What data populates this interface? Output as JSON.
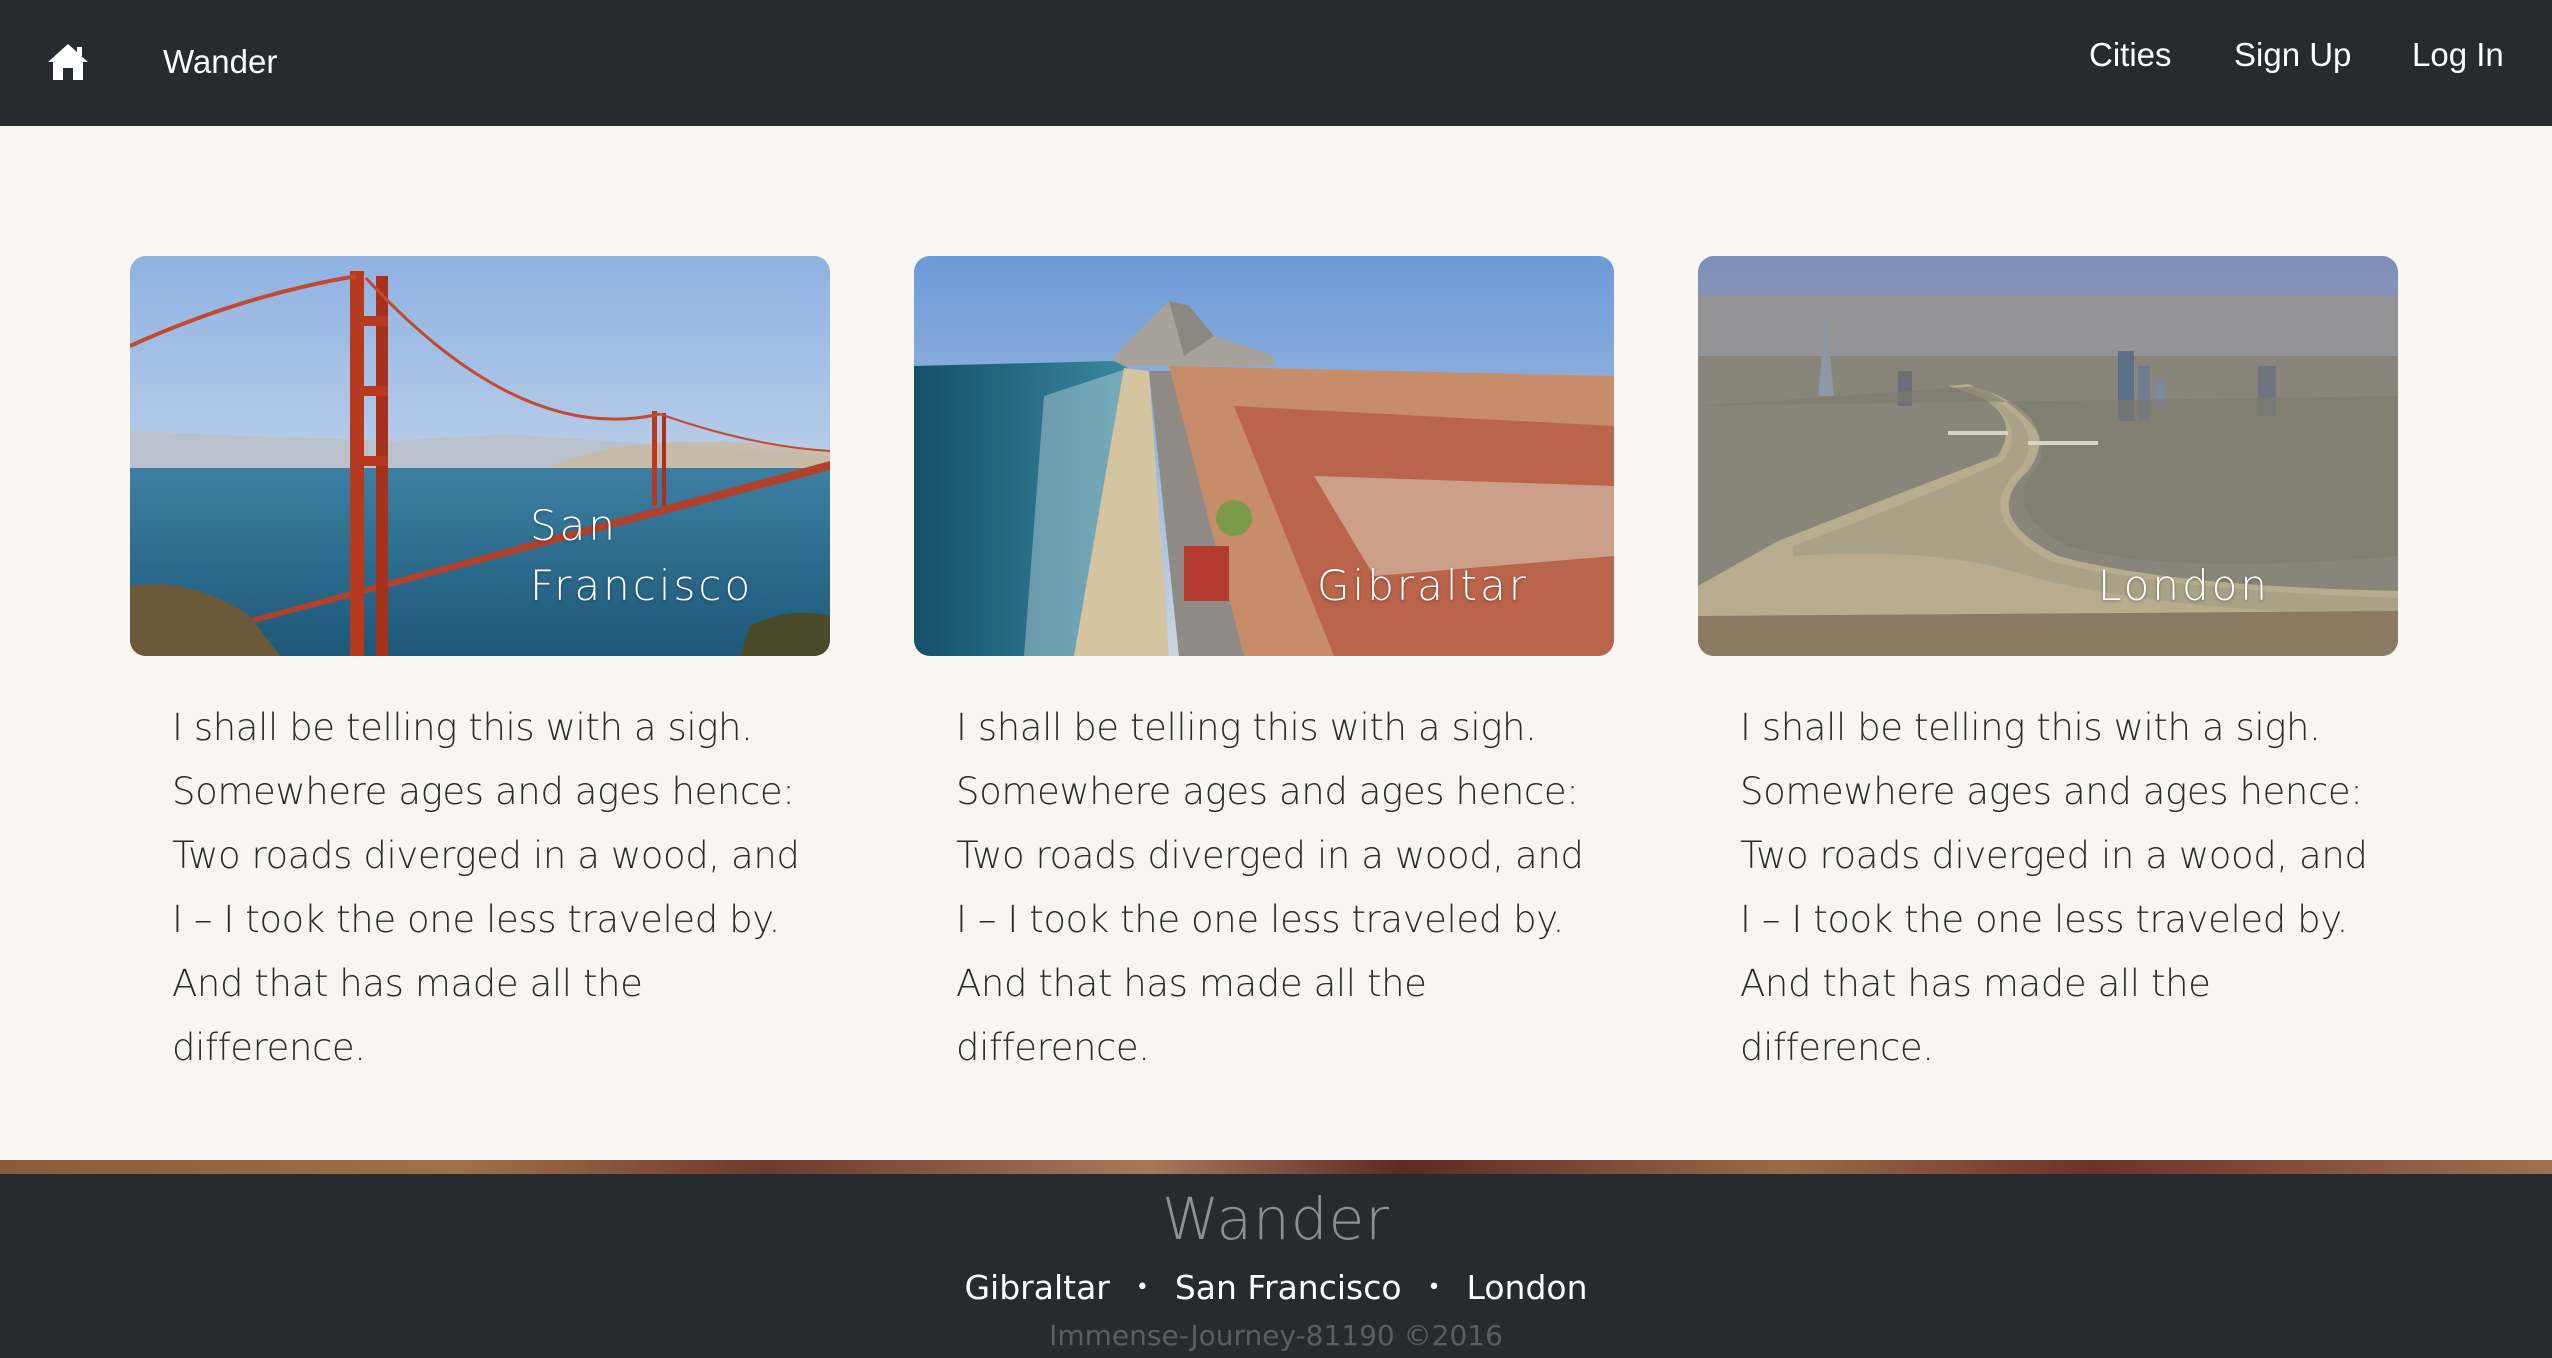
{
  "navbar": {
    "home_icon": "home-icon",
    "brand": "Wander",
    "links": {
      "cities": "Cities",
      "sign_up": "Sign Up",
      "log_in": "Log In"
    }
  },
  "cards": [
    {
      "title": "San Francisco",
      "image": "golden-gate-bridge-photo",
      "text": "I shall be telling this with a sigh. Somewhere ages and ages hence: Two roads diverged in a wood, and I – I took the one less traveled by. And that has made all the difference."
    },
    {
      "title": "Gibraltar",
      "image": "gibraltar-coast-photo",
      "text": "I shall be telling this with a sigh. Somewhere ages and ages hence: Two roads diverged in a wood, and I – I took the one less traveled by. And that has made all the difference."
    },
    {
      "title": "London",
      "image": "london-thames-aerial-photo",
      "text": "I shall be telling this with a sigh. Somewhere ages and ages hence: Two roads diverged in a wood, and I – I took the one less traveled by. And that has made all the difference."
    }
  ],
  "footer": {
    "brand": "Wander",
    "links": [
      "Gibraltar",
      "San Francisco",
      "London"
    ],
    "separator": "•",
    "copyright": "Immense-Journey-81190 ©2016"
  }
}
